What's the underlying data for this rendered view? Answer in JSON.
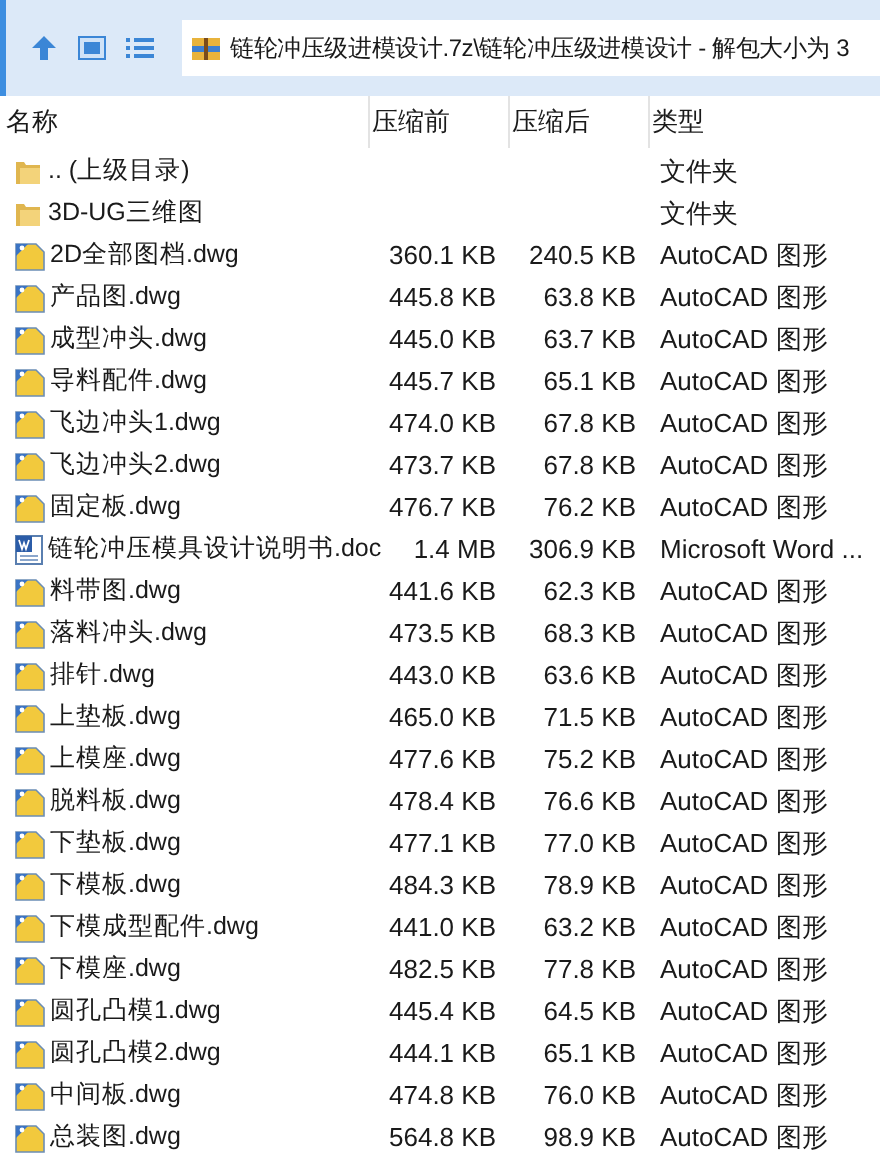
{
  "toolbar": {
    "address": "链轮冲压级进模设计.7z\\链轮冲压级进模设计 - 解包大小为 3"
  },
  "columns": [
    "名称",
    "压缩前",
    "压缩后",
    "类型"
  ],
  "rows": [
    {
      "kind": "folder",
      "name": ".. (上级目录)",
      "type": "文件夹"
    },
    {
      "kind": "folder",
      "name": "3D-UG三维图",
      "type": "文件夹"
    },
    {
      "kind": "dwg",
      "name": "2D全部图档.dwg",
      "size": "360.1 KB",
      "packed": "240.5 KB",
      "type": "AutoCAD 图形"
    },
    {
      "kind": "dwg",
      "name": "产品图.dwg",
      "size": "445.8 KB",
      "packed": "63.8 KB",
      "type": "AutoCAD 图形"
    },
    {
      "kind": "dwg",
      "name": "成型冲头.dwg",
      "size": "445.0 KB",
      "packed": "63.7 KB",
      "type": "AutoCAD 图形"
    },
    {
      "kind": "dwg",
      "name": "导料配件.dwg",
      "size": "445.7 KB",
      "packed": "65.1 KB",
      "type": "AutoCAD 图形"
    },
    {
      "kind": "dwg",
      "name": "飞边冲头1.dwg",
      "size": "474.0 KB",
      "packed": "67.8 KB",
      "type": "AutoCAD 图形"
    },
    {
      "kind": "dwg",
      "name": "飞边冲头2.dwg",
      "size": "473.7 KB",
      "packed": "67.8 KB",
      "type": "AutoCAD 图形"
    },
    {
      "kind": "dwg",
      "name": "固定板.dwg",
      "size": "476.7 KB",
      "packed": "76.2 KB",
      "type": "AutoCAD 图形"
    },
    {
      "kind": "doc",
      "name": "链轮冲压模具设计说明书.doc",
      "size": "1.4 MB",
      "packed": "306.9 KB",
      "type": "Microsoft Word ..."
    },
    {
      "kind": "dwg",
      "name": "料带图.dwg",
      "size": "441.6 KB",
      "packed": "62.3 KB",
      "type": "AutoCAD 图形"
    },
    {
      "kind": "dwg",
      "name": "落料冲头.dwg",
      "size": "473.5 KB",
      "packed": "68.3 KB",
      "type": "AutoCAD 图形"
    },
    {
      "kind": "dwg",
      "name": "排针.dwg",
      "size": "443.0 KB",
      "packed": "63.6 KB",
      "type": "AutoCAD 图形"
    },
    {
      "kind": "dwg",
      "name": "上垫板.dwg",
      "size": "465.0 KB",
      "packed": "71.5 KB",
      "type": "AutoCAD 图形"
    },
    {
      "kind": "dwg",
      "name": "上模座.dwg",
      "size": "477.6 KB",
      "packed": "75.2 KB",
      "type": "AutoCAD 图形"
    },
    {
      "kind": "dwg",
      "name": "脱料板.dwg",
      "size": "478.4 KB",
      "packed": "76.6 KB",
      "type": "AutoCAD 图形"
    },
    {
      "kind": "dwg",
      "name": "下垫板.dwg",
      "size": "477.1 KB",
      "packed": "77.0 KB",
      "type": "AutoCAD 图形"
    },
    {
      "kind": "dwg",
      "name": "下模板.dwg",
      "size": "484.3 KB",
      "packed": "78.9 KB",
      "type": "AutoCAD 图形"
    },
    {
      "kind": "dwg",
      "name": "下模成型配件.dwg",
      "size": "441.0 KB",
      "packed": "63.2 KB",
      "type": "AutoCAD 图形"
    },
    {
      "kind": "dwg",
      "name": "下模座.dwg",
      "size": "482.5 KB",
      "packed": "77.8 KB",
      "type": "AutoCAD 图形"
    },
    {
      "kind": "dwg",
      "name": "圆孔凸模1.dwg",
      "size": "445.4 KB",
      "packed": "64.5 KB",
      "type": "AutoCAD 图形"
    },
    {
      "kind": "dwg",
      "name": "圆孔凸模2.dwg",
      "size": "444.1 KB",
      "packed": "65.1 KB",
      "type": "AutoCAD 图形"
    },
    {
      "kind": "dwg",
      "name": "中间板.dwg",
      "size": "474.8 KB",
      "packed": "76.0 KB",
      "type": "AutoCAD 图形"
    },
    {
      "kind": "dwg",
      "name": "总装图.dwg",
      "size": "564.8 KB",
      "packed": "98.9 KB",
      "type": "AutoCAD 图形"
    }
  ]
}
